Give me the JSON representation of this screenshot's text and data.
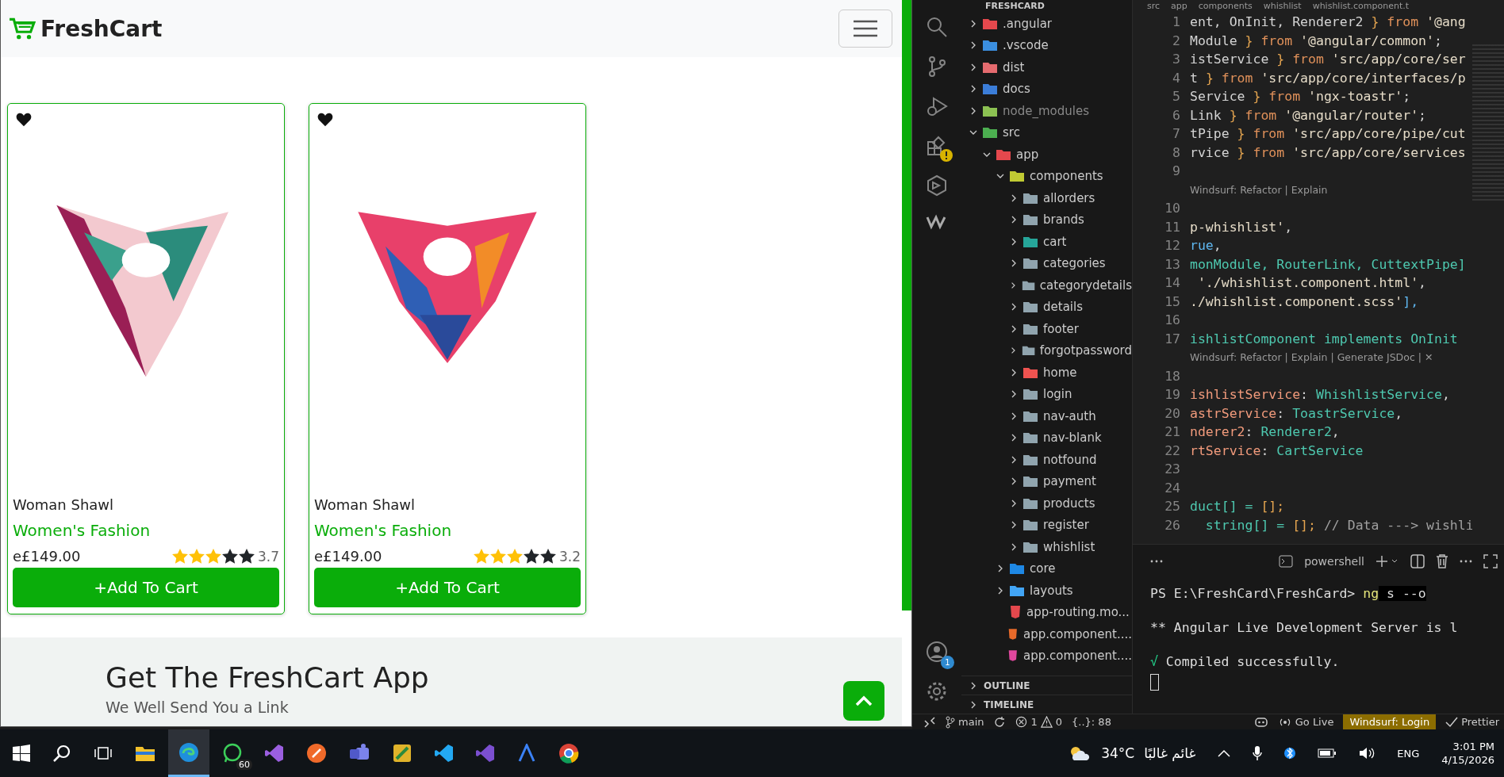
{
  "browser": {
    "brand": "FreshCart",
    "products": [
      {
        "name": "Woman Shawl",
        "category": "Women's Fashion",
        "price": "e£149.00",
        "stars": 3,
        "rating": "3.7",
        "button": "+Add To Cart",
        "favorite": true
      },
      {
        "name": "Woman Shawl",
        "category": "Women's Fashion",
        "price": "e£149.00",
        "stars": 3,
        "rating": "3.2",
        "button": "+Add To Cart",
        "favorite": true
      }
    ],
    "footer": {
      "title": "Get The FreshCart App",
      "subtitle": "We Well Send You a Link"
    }
  },
  "vscode": {
    "explorer": {
      "title": "FRESHCARD",
      "tree": [
        {
          "label": ".angular",
          "kind": "angular",
          "expanded": false
        },
        {
          "label": ".vscode",
          "kind": "vscode",
          "expanded": false
        },
        {
          "label": "dist",
          "kind": "dist",
          "expanded": false
        },
        {
          "label": "docs",
          "kind": "docs",
          "expanded": false
        },
        {
          "label": "node_modules",
          "kind": "node",
          "expanded": false
        },
        {
          "label": "src",
          "kind": "src",
          "expanded": true,
          "children": [
            {
              "label": "app",
              "kind": "app",
              "expanded": true,
              "children": [
                {
                  "label": "components",
                  "kind": "components",
                  "expanded": true,
                  "children": [
                    {
                      "label": "allorders",
                      "kind": "folder",
                      "expanded": false
                    },
                    {
                      "label": "brands",
                      "kind": "folder",
                      "expanded": false
                    },
                    {
                      "label": "cart",
                      "kind": "cart",
                      "expanded": false
                    },
                    {
                      "label": "categories",
                      "kind": "folder",
                      "expanded": false
                    },
                    {
                      "label": "categorydetails",
                      "kind": "folder",
                      "expanded": false
                    },
                    {
                      "label": "details",
                      "kind": "folder",
                      "expanded": false
                    },
                    {
                      "label": "footer",
                      "kind": "folder",
                      "expanded": false
                    },
                    {
                      "label": "forgotpassword",
                      "kind": "folder",
                      "expanded": false
                    },
                    {
                      "label": "home",
                      "kind": "home",
                      "expanded": false
                    },
                    {
                      "label": "login",
                      "kind": "folder",
                      "expanded": false
                    },
                    {
                      "label": "nav-auth",
                      "kind": "folder",
                      "expanded": false
                    },
                    {
                      "label": "nav-blank",
                      "kind": "folder",
                      "expanded": false
                    },
                    {
                      "label": "notfound",
                      "kind": "folder",
                      "expanded": false
                    },
                    {
                      "label": "payment",
                      "kind": "folder",
                      "expanded": false
                    },
                    {
                      "label": "products",
                      "kind": "folder",
                      "expanded": false
                    },
                    {
                      "label": "register",
                      "kind": "folder",
                      "expanded": false
                    },
                    {
                      "label": "whishlist",
                      "kind": "folder",
                      "expanded": false
                    }
                  ]
                },
                {
                  "label": "core",
                  "kind": "core",
                  "expanded": false
                },
                {
                  "label": "layouts",
                  "kind": "layouts",
                  "expanded": false
                },
                {
                  "label": "app-routing.mo...",
                  "kind": "angular-file"
                },
                {
                  "label": "app.component....",
                  "kind": "html"
                },
                {
                  "label": "app.component....",
                  "kind": "sass"
                }
              ]
            }
          ]
        }
      ],
      "sections": [
        "OUTLINE",
        "TIMELINE"
      ]
    },
    "account_badge": "1",
    "breadcrumb": [
      "src",
      "app",
      "components",
      "whishlist",
      "whishlist.component.t"
    ],
    "lines": [
      {
        "kind": "code",
        "number": "1",
        "tokens": [
          {
            "text": "ent, OnInit, Renderer2 ",
            "color": "#d4d4d4"
          },
          {
            "text": "}",
            "color": "#e5a550"
          },
          {
            "text": " from ",
            "color": "#e0915a"
          },
          {
            "text": "'@ang",
            "color": "#e6dcc8"
          }
        ]
      },
      {
        "kind": "code",
        "number": "2",
        "tokens": [
          {
            "text": "Module ",
            "color": "#d4d4d4"
          },
          {
            "text": "}",
            "color": "#e5a550"
          },
          {
            "text": " from ",
            "color": "#e0915a"
          },
          {
            "text": "'@angular/common'",
            "color": "#e6dcc8"
          },
          {
            "text": ";",
            "color": "#d4d4d4"
          }
        ]
      },
      {
        "kind": "code",
        "number": "3",
        "tokens": [
          {
            "text": "istService ",
            "color": "#d4d4d4"
          },
          {
            "text": "}",
            "color": "#e5a550"
          },
          {
            "text": " from ",
            "color": "#e0915a"
          },
          {
            "text": "'src/app/core/ser",
            "color": "#e6dcc8"
          }
        ]
      },
      {
        "kind": "code",
        "number": "4",
        "tokens": [
          {
            "text": "t ",
            "color": "#d4d4d4"
          },
          {
            "text": "}",
            "color": "#e5a550"
          },
          {
            "text": " from ",
            "color": "#e0915a"
          },
          {
            "text": "'src/app/core/interfaces/p",
            "color": "#e6dcc8"
          }
        ]
      },
      {
        "kind": "code",
        "number": "5",
        "tokens": [
          {
            "text": "Service ",
            "color": "#d4d4d4"
          },
          {
            "text": "}",
            "color": "#e5a550"
          },
          {
            "text": " from ",
            "color": "#e0915a"
          },
          {
            "text": "'ngx-toastr'",
            "color": "#e6dcc8"
          },
          {
            "text": ";",
            "color": "#d4d4d4"
          }
        ]
      },
      {
        "kind": "code",
        "number": "6",
        "tokens": [
          {
            "text": "Link ",
            "color": "#d4d4d4"
          },
          {
            "text": "}",
            "color": "#e5a550"
          },
          {
            "text": " from ",
            "color": "#e0915a"
          },
          {
            "text": "'@angular/router'",
            "color": "#e6dcc8"
          },
          {
            "text": ";",
            "color": "#d4d4d4"
          }
        ]
      },
      {
        "kind": "code",
        "number": "7",
        "tokens": [
          {
            "text": "tPipe ",
            "color": "#d4d4d4"
          },
          {
            "text": "}",
            "color": "#e5a550"
          },
          {
            "text": " from ",
            "color": "#e0915a"
          },
          {
            "text": "'src/app/core/pipe/cut",
            "color": "#e6dcc8"
          }
        ]
      },
      {
        "kind": "code",
        "number": "8",
        "tokens": [
          {
            "text": "rvice ",
            "color": "#d4d4d4"
          },
          {
            "text": "}",
            "color": "#e5a550"
          },
          {
            "text": " from ",
            "color": "#e0915a"
          },
          {
            "text": "'src/app/core/services",
            "color": "#e6dcc8"
          }
        ]
      },
      {
        "kind": "code",
        "number": "9"
      },
      {
        "kind": "lens",
        "text": "Windsurf: Refactor | Explain"
      },
      {
        "kind": "code",
        "number": "10"
      },
      {
        "kind": "code",
        "number": "11",
        "tokens": [
          {
            "text": "p-whishlist'",
            "color": "#e6dcc8"
          },
          {
            "text": ",",
            "color": "#d4d4d4"
          }
        ]
      },
      {
        "kind": "code",
        "number": "12",
        "tokens": [
          {
            "text": "rue",
            "color": "#5fb7f0"
          },
          {
            "text": ",",
            "color": "#d4d4d4"
          }
        ]
      },
      {
        "kind": "code",
        "number": "13",
        "tokens": [
          {
            "text": "monModule, ",
            "color": "#4ec9b0"
          },
          {
            "text": "RouterLink, ",
            "color": "#4ec9b0"
          },
          {
            "text": "CuttextPipe]",
            "color": "#4ec9b0"
          }
        ]
      },
      {
        "kind": "code",
        "number": "14",
        "tokens": [
          {
            "text": " './whishlist.component.html'",
            "color": "#e6dcc8"
          },
          {
            "text": ",",
            "color": "#d4d4d4"
          }
        ]
      },
      {
        "kind": "code",
        "number": "15",
        "tokens": [
          {
            "text": "./whishlist.component.scss'",
            "color": "#e6dcc8"
          },
          {
            "text": "],",
            "color": "#5fb7f0"
          }
        ]
      },
      {
        "kind": "code",
        "number": "16"
      },
      {
        "kind": "code",
        "number": "17",
        "tokens": [
          {
            "text": "ishlistComponent ",
            "color": "#4ec9b0"
          },
          {
            "text": "implements ",
            "color": "#4ec9b0"
          },
          {
            "text": "OnInit",
            "color": "#4ec9b0"
          }
        ]
      },
      {
        "kind": "lens",
        "text": "Windsurf: Refactor | Explain | Generate JSDoc | ✕"
      },
      {
        "kind": "code",
        "number": "18"
      },
      {
        "kind": "code",
        "number": "19",
        "tokens": [
          {
            "text": "ishlistService",
            "color": "#f29b7c"
          },
          {
            "text": ": ",
            "color": "#d4d4d4"
          },
          {
            "text": "WhishlistService",
            "color": "#4ec9b0"
          },
          {
            "text": ",",
            "color": "#d4d4d4"
          }
        ]
      },
      {
        "kind": "code",
        "number": "20",
        "tokens": [
          {
            "text": "astrService",
            "color": "#f29b7c"
          },
          {
            "text": ": ",
            "color": "#d4d4d4"
          },
          {
            "text": "ToastrService",
            "color": "#4ec9b0"
          },
          {
            "text": ",",
            "color": "#d4d4d4"
          }
        ]
      },
      {
        "kind": "code",
        "number": "21",
        "tokens": [
          {
            "text": "nderer2",
            "color": "#f29b7c"
          },
          {
            "text": ": ",
            "color": "#d4d4d4"
          },
          {
            "text": "Renderer2",
            "color": "#4ec9b0"
          },
          {
            "text": ",",
            "color": "#d4d4d4"
          }
        ]
      },
      {
        "kind": "code",
        "number": "22",
        "tokens": [
          {
            "text": "rtService",
            "color": "#f29b7c"
          },
          {
            "text": ": ",
            "color": "#d4d4d4"
          },
          {
            "text": "CartService",
            "color": "#4ec9b0"
          }
        ]
      },
      {
        "kind": "code",
        "number": "23"
      },
      {
        "kind": "code",
        "number": "24"
      },
      {
        "kind": "code",
        "number": "25",
        "tokens": [
          {
            "text": "duct[] = ",
            "color": "#4ec9b0"
          },
          {
            "text": "[];",
            "color": "#e5a550"
          }
        ]
      },
      {
        "kind": "code",
        "number": "26",
        "tokens": [
          {
            "text": "  string[] = ",
            "color": "#4ec9b0"
          },
          {
            "text": "[]; ",
            "color": "#e5a550"
          },
          {
            "text": "// Data ---> wishli",
            "color": "#a0a0a0"
          }
        ]
      }
    ],
    "terminal": {
      "shell": "powershell",
      "prompt": "PS E:\\FreshCard\\FreshCard> ",
      "command": "ng",
      "args": " s --o",
      "output": "** Angular Live Development Server is l",
      "check": "√",
      "success": "Compiled successfully."
    },
    "status": {
      "branch": "main",
      "errors": "1",
      "warnings": "0",
      "position": "{..}: 88",
      "golive": "Go Live",
      "windsurf": "Windsurf: Login",
      "prettier": "Prettier"
    }
  },
  "taskbar": {
    "whatsapp_badge": "60",
    "temperature": "34°C",
    "weather": "غائم غالبًا",
    "language": "ENG",
    "time": "3:01 PM",
    "date": "4/15/2026"
  }
}
